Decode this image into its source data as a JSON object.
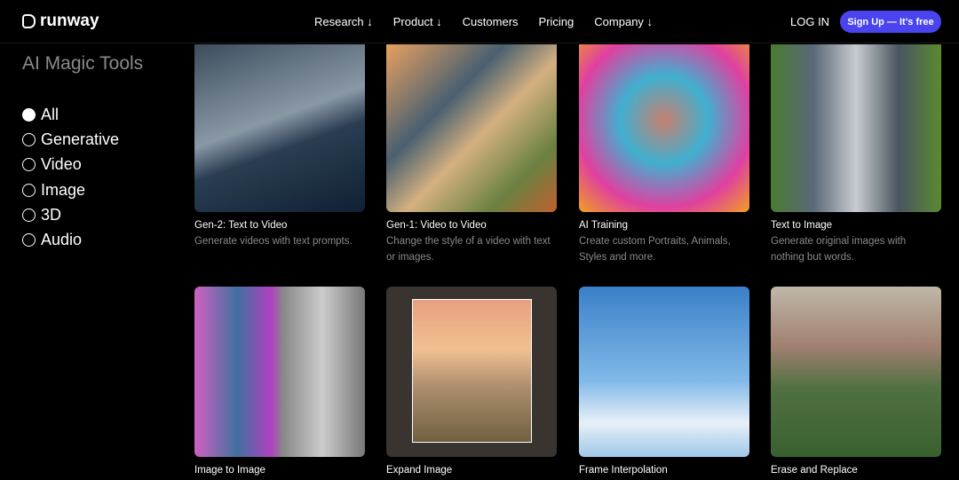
{
  "header": {
    "brand": "runway",
    "nav": [
      "Research ↓",
      "Product ↓",
      "Customers",
      "Pricing",
      "Company ↓"
    ],
    "login": "LOG IN",
    "signup": "Sign Up — It's free"
  },
  "sidebar": {
    "title": "AI Magic Tools",
    "filters": [
      {
        "label": "All",
        "selected": true
      },
      {
        "label": "Generative",
        "selected": false
      },
      {
        "label": "Video",
        "selected": false
      },
      {
        "label": "Image",
        "selected": false
      },
      {
        "label": "3D",
        "selected": false
      },
      {
        "label": "Audio",
        "selected": false
      }
    ]
  },
  "cards": [
    {
      "title": "Gen-2: Text to Video",
      "desc": "Generate videos with text prompts."
    },
    {
      "title": "Gen-1: Video to Video",
      "desc": "Change the style of a video with text or images."
    },
    {
      "title": "AI Training",
      "desc": "Create custom Portraits, Animals, Styles and more."
    },
    {
      "title": "Text to Image",
      "desc": "Generate original images with nothing but words."
    },
    {
      "title": "Image to Image",
      "desc": ""
    },
    {
      "title": "Expand Image",
      "desc": ""
    },
    {
      "title": "Frame Interpolation",
      "desc": ""
    },
    {
      "title": "Erase and Replace",
      "desc": ""
    }
  ]
}
